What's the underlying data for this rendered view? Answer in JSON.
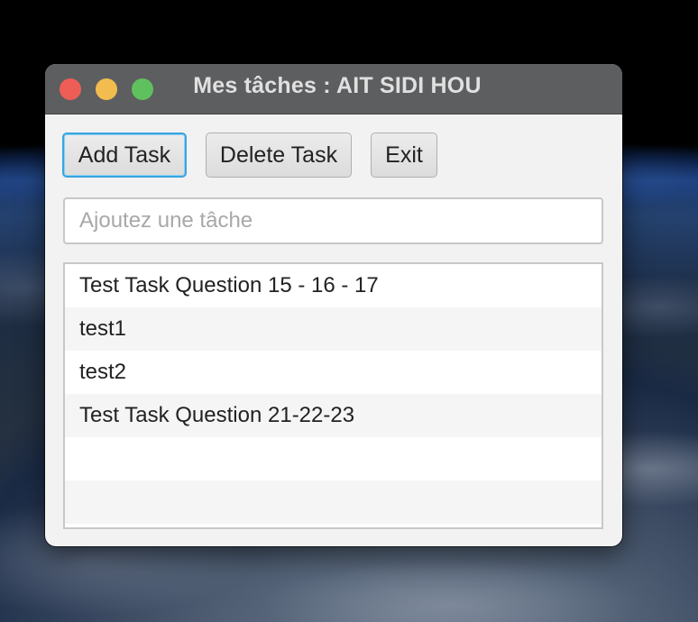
{
  "window": {
    "title": "Mes tâches : AIT SIDI HOU"
  },
  "toolbar": {
    "add_label": "Add Task",
    "delete_label": "Delete Task",
    "exit_label": "Exit"
  },
  "task_input": {
    "placeholder": "Ajoutez une tâche",
    "value": ""
  },
  "tasks": [
    "Test Task Question 15 - 16 - 17",
    "test1",
    "test2",
    "Test Task Question 21-22-23",
    "",
    ""
  ],
  "icons": {
    "close": "close-icon",
    "minimize": "minimize-icon",
    "maximize": "maximize-icon"
  },
  "colors": {
    "titlebar": "#5d5e60",
    "close": "#ee5e57",
    "minimize": "#f2bd4e",
    "maximize": "#5ec15d",
    "focus_ring": "#39a5e0"
  }
}
